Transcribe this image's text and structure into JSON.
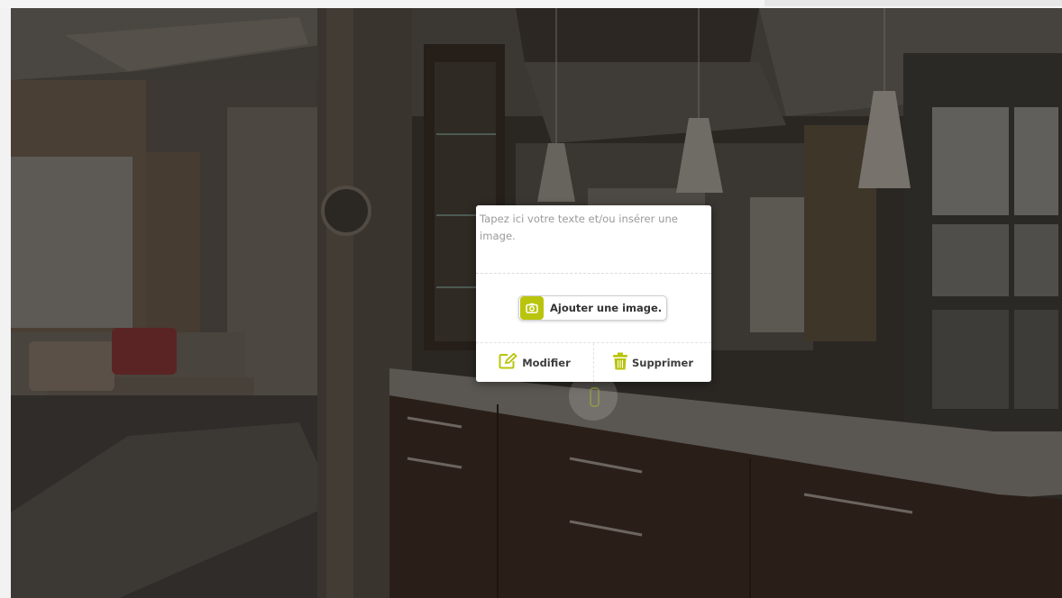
{
  "popup": {
    "placeholder": "Tapez ici votre texte et/ou insérer une image.",
    "add_image_label": "Ajouter une image.",
    "edit_label": "Modifier",
    "delete_label": "Supprimer"
  },
  "icons": {
    "camera": "camera-icon",
    "edit": "edit-icon",
    "delete": "trash-icon",
    "hotspot": "hotspot-pin-icon"
  },
  "colors": {
    "accent": "#b9c40c",
    "overlay": "#2a2723"
  }
}
